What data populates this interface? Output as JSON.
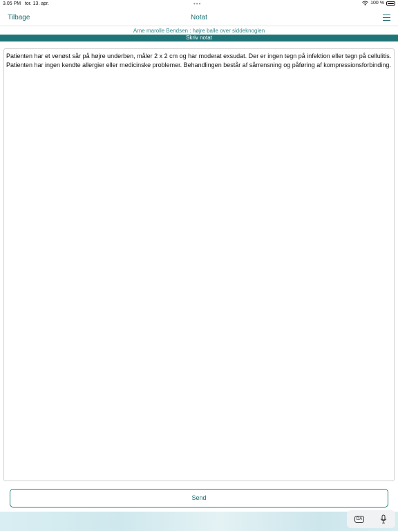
{
  "status_bar": {
    "time": "3.05 PM",
    "date": "tor. 13. apr.",
    "dots": "•••",
    "battery": "100 %"
  },
  "nav": {
    "back_label": "Tilbage",
    "title": "Notat"
  },
  "patient_line": "Arne marolle Bendsen : højre balle over siddeknoglen",
  "section_title": "Skriv notat",
  "note_text": "Patienten har et venøst sår på højre underben, måler 2 x 2 cm og har moderat exsudat. Der er ingen tegn på infektion eller tegn på cellulitis. Patienten har ingen kendte allergier eller medicinske problemer. Behandlingen består af sårrensning og påføring af kompressionsforbinding.",
  "send_label": "Send",
  "keyboard": {
    "language": "DA"
  },
  "icons": {
    "wifi": "wifi-icon",
    "battery": "battery-icon",
    "menu": "hamburger-menu-icon",
    "mic": "microphone-icon",
    "language": "keyboard-language-icon"
  },
  "colors": {
    "accent": "#1c6f73",
    "band": "#1f7477"
  }
}
